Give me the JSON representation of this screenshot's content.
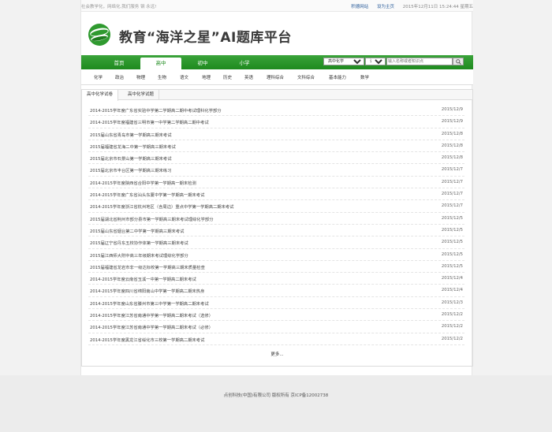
{
  "topbar": {
    "slogan": "社会教学化，网络化,我们服务 钢 永远!",
    "links": [
      "积德网站",
      "设为主页"
    ],
    "datetime": "2015年12月11日 15:24:44 星期五"
  },
  "logo": {
    "title": "教育“海洋之星”AI题库平台",
    "icon": "globe-swoosh-icon",
    "colors": {
      "green": "#2f9a2f",
      "dark": "#1e7a1e"
    }
  },
  "nav": {
    "tabs": [
      {
        "label": "首页",
        "active": false
      },
      {
        "label": "高中",
        "active": true
      },
      {
        "label": "初中",
        "active": false
      },
      {
        "label": "小学",
        "active": false
      }
    ],
    "search": {
      "subject_selected": "高中化学",
      "type_selected": "试题",
      "placeholder": "输入名称或者知识点",
      "button_icon": "search-icon"
    }
  },
  "subnav": {
    "items": [
      "化学",
      "政治",
      "物理",
      "生物",
      "语文",
      "地理",
      "历史",
      "英语",
      "理科综合",
      "文科综合",
      "基本能力",
      "数学"
    ]
  },
  "panel": {
    "tabs": [
      {
        "label": "高中化学试卷",
        "active": true
      },
      {
        "label": "高中化学试题",
        "active": false
      }
    ],
    "rows": [
      {
        "title": "2014-2015学年度广东省实验中学第二学期高二期中考试理科化学部分",
        "date": "2015/12/9"
      },
      {
        "title": "2014-2015学年度福建省三明市第一中学第二学期高二期中考试",
        "date": "2015/12/9"
      },
      {
        "title": "2015届山东省青岛市第一学期高三期末考试",
        "date": "2015/12/8"
      },
      {
        "title": "2015届福建省龙海二中第一学期高三期末考试",
        "date": "2015/12/8"
      },
      {
        "title": "2015届北京市石景山第一学期高三期末考试",
        "date": "2015/12/8"
      },
      {
        "title": "2015届北京市丰台区第一学期高三期末练习",
        "date": "2015/12/7"
      },
      {
        "title": "2014-2015学年度陕西省合阳中学第一学期高一期末检测",
        "date": "2015/12/7"
      },
      {
        "title": "2014-2015学年度广东省汕头东厦中学第一学期高一期末考试",
        "date": "2015/12/7"
      },
      {
        "title": "2014-2015学年度浙江省杭州地区（含周边）重点中学第一学期高二期末考试",
        "date": "2015/12/7"
      },
      {
        "title": "2015届湖北省荆州市部分县市第一学期高三期末考试理综化学部分",
        "date": "2015/12/5"
      },
      {
        "title": "2015届山东省烟台第二中学第一学期高三期末考试",
        "date": "2015/12/5"
      },
      {
        "title": "2015届辽宁省丹东五校协作体第一学期高三期末考试",
        "date": "2015/12/5"
      },
      {
        "title": "2015届江西师大附中高三年级期末考试理综化学部分",
        "date": "2015/12/5"
      },
      {
        "title": "2015届福建省龙岩市非一级达标校第一学期高三期末质量检查",
        "date": "2015/12/5"
      },
      {
        "title": "2014-2015学年度云南省玉溪一中第一学期高二期末考试",
        "date": "2015/12/4"
      },
      {
        "title": "2014-2015学年度四川省绵阳南山中学第一学期高二期末热身",
        "date": "2015/12/4"
      },
      {
        "title": "2014-2015学年度山东省滕州市第三中学第一学期高二期末考试",
        "date": "2015/12/3"
      },
      {
        "title": "2014-2015学年度江苏省南通中学第一学期高二期末考试（选修）",
        "date": "2015/12/2"
      },
      {
        "title": "2014-2015学年度江苏省南通中学第一学期高二期末考试（必修）",
        "date": "2015/12/2"
      },
      {
        "title": "2014-2015学年度黑龙江省绥化市三校第一学期高二期末考试",
        "date": "2015/12/2"
      }
    ],
    "more": "更多..."
  },
  "footer": {
    "copyright": "点创科技(中国)有限公司 版权所有 京ICP备12002738"
  }
}
